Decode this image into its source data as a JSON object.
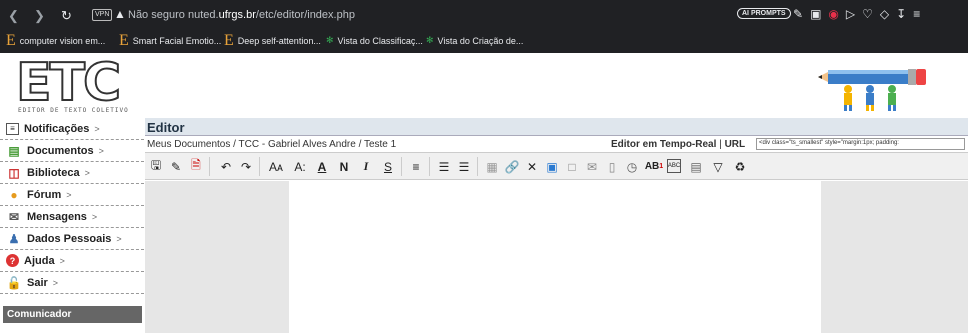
{
  "browser": {
    "vpn": "VPN",
    "insecure_label": "Não seguro",
    "url_prefix": "nuted.",
    "url_domain": "ufrgs.br",
    "url_path": "/etc/editor/index.php",
    "ai_prompts": "AI PROMPTS",
    "bookmarks": [
      {
        "icon": "E",
        "label": "computer vision em..."
      },
      {
        "icon": "E",
        "label": "Smart Facial Emotio..."
      },
      {
        "icon": "E",
        "label": "Deep self-attention..."
      },
      {
        "icon": "g",
        "label": "Vista do Classificaç..."
      },
      {
        "icon": "g",
        "label": "Vista do Criação de..."
      }
    ]
  },
  "logo": {
    "text": "ETC",
    "subtitle": "EDITOR DE TEXTO COLETIVO"
  },
  "sidebar": {
    "items": [
      {
        "label": "Notificações",
        "arrow": ">",
        "icon": "notifications-icon"
      },
      {
        "label": "Documentos",
        "arrow": ">",
        "icon": "documents-icon"
      },
      {
        "label": "Biblioteca",
        "arrow": ">",
        "icon": "library-icon"
      },
      {
        "label": "Fórum",
        "arrow": ">",
        "icon": "forum-icon"
      },
      {
        "label": "Mensagens",
        "arrow": ">",
        "icon": "messages-icon"
      },
      {
        "label": "Dados Pessoais",
        "arrow": ">",
        "icon": "personal-data-icon"
      },
      {
        "label": "Ajuda",
        "arrow": ">",
        "icon": "help-icon"
      },
      {
        "label": "Sair",
        "arrow": ">",
        "icon": "logout-icon"
      }
    ],
    "comunicador": "Comunicador"
  },
  "editor": {
    "title": "Editor",
    "breadcrumb": "Meus Documentos / TCC - Gabriel Alves Andre / Teste 1",
    "realtime": "Editor em Tempo-Real",
    "separator": "|",
    "url_label": "URL",
    "url_value": "<div class=\"ts_smallest\" style=\"margin:1px; padding:"
  },
  "toolbar": {
    "font_grow": "Aᴀ",
    "font_shrink": "A:",
    "font_color": "A",
    "bold": "N",
    "italic": "I",
    "strike": "S",
    "superscript": "AB",
    "sup_mark": "1",
    "spell": "ABC"
  },
  "colors": {
    "header_bg": "#dfe6ed",
    "sidebar_comm": "#666666",
    "editor_bg": "#e6e6e6"
  }
}
